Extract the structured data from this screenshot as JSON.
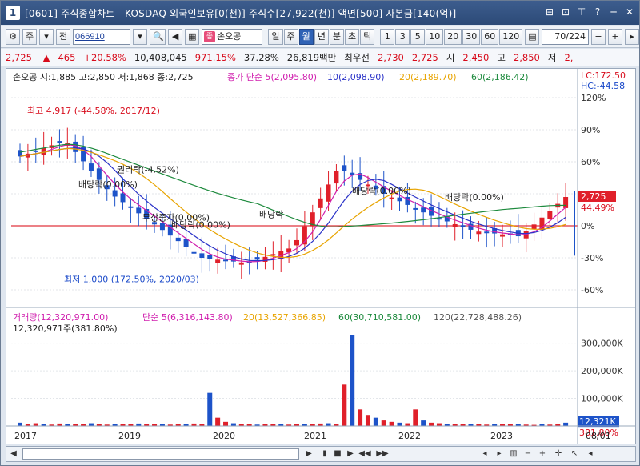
{
  "window": {
    "number": "1",
    "title": "[0601] 주식종합차트 - KOSDAQ 외국인보유[0(천)] 주식수[27,922(천)] 액면[500] 자본금[140(억)]",
    "controls": [
      "⊟",
      "⊡",
      "⊤",
      "?",
      "─",
      "✕"
    ]
  },
  "toolbar": {
    "mode_label": "주",
    "prev_label": "전",
    "code_value": "066910",
    "name_badge": "종",
    "name_value": "손오공",
    "period_buttons": [
      "일",
      "주",
      "월",
      "년",
      "분",
      "초",
      "틱"
    ],
    "selected_period": "월",
    "interval_buttons": [
      "1",
      "3",
      "5",
      "10",
      "20",
      "30",
      "60",
      "120"
    ],
    "count_value": "70",
    "count_total": "/224"
  },
  "quote": {
    "price": "2,725",
    "change": "465",
    "change_pct": "+20.58%",
    "volume": "10,408,045",
    "volume_ratio": "971.15%",
    "turnover": "37.28%",
    "amount": "26,819백만",
    "best_ask_label": "최우선",
    "best_ask": "2,730",
    "best_bid": "2,725",
    "open_label": "시",
    "open": "2,450",
    "high_label": "고",
    "high": "2,850",
    "low_label": "저",
    "low": "2,"
  },
  "chart_data": [
    {
      "type": "candlestick",
      "title": "손오공 시:1,885 고:2,850 저:1,868 종:2,725",
      "legend": [
        {
          "name": "종가 단순 5",
          "value": "2,095.80",
          "color": "#d01fae"
        },
        {
          "name": "10",
          "value": "2,098.90",
          "color": "#2a32c8"
        },
        {
          "name": "20",
          "value": "2,189.70",
          "color": "#e8a400"
        },
        {
          "name": "60",
          "value": "2,186.42",
          "color": "#1d8a3d"
        }
      ],
      "right_info": [
        "LC:172.50",
        "HC:-44.58"
      ],
      "y_ticks_pct": [
        "120%",
        "90%",
        "60%",
        "30%",
        "0%",
        "-30%",
        "-60%"
      ],
      "current_label": "2,725",
      "current_pct": "44.49%",
      "x_axis": [
        "2017",
        "2019",
        "2020",
        "2021",
        "2022",
        "2023",
        "08/01"
      ],
      "annotations": [
        "최고 4,917 (-44.58%, 2017/12)",
        "권리락(-4.52%)",
        "배당락(0.00%)",
        "무상증자(0.00%)",
        "배당락",
        "배당락(0.00%)",
        "배당락(0.00%)",
        "배당락(0.00%)",
        "최저 1,000 (172.50%, 2020/03)"
      ],
      "series_pct_approx": [
        {
          "period": "2017-08",
          "close_pct": 65
        },
        {
          "period": "2017-12",
          "close_pct": 80
        },
        {
          "period": "2018-06",
          "close_pct": 30
        },
        {
          "period": "2019-01",
          "close_pct": 0
        },
        {
          "period": "2019-08",
          "close_pct": -30
        },
        {
          "period": "2020-03",
          "close_pct": -35
        },
        {
          "period": "2020-08",
          "close_pct": -20
        },
        {
          "period": "2021-01",
          "close_pct": 55
        },
        {
          "period": "2021-06",
          "close_pct": 30
        },
        {
          "period": "2022-01",
          "close_pct": 10
        },
        {
          "period": "2022-08",
          "close_pct": -5
        },
        {
          "period": "2023-03",
          "close_pct": -10
        },
        {
          "period": "2023-08",
          "close_pct": 27
        }
      ]
    },
    {
      "type": "bar",
      "title": "거래량(12,320,971.00)",
      "legend": [
        {
          "name": "거래량",
          "value": "12,320,971.00",
          "color": "#d01fae"
        },
        {
          "name": "단순 5",
          "value": "6,316,143.80",
          "color": "#d01fae"
        },
        {
          "name": "20",
          "value": "13,527,366.85",
          "color": "#e8a400"
        },
        {
          "name": "60",
          "value": "30,710,581.00",
          "color": "#1d8a3d"
        },
        {
          "name": "120",
          "value": "22,728,488.26",
          "color": "#555"
        }
      ],
      "sub_label": "12,320,971주(381.80%)",
      "y_ticks": [
        "300,000K",
        "200,000K",
        "100,000K"
      ],
      "current_label": "12,321K",
      "current_pct": "381.80%"
    }
  ]
}
